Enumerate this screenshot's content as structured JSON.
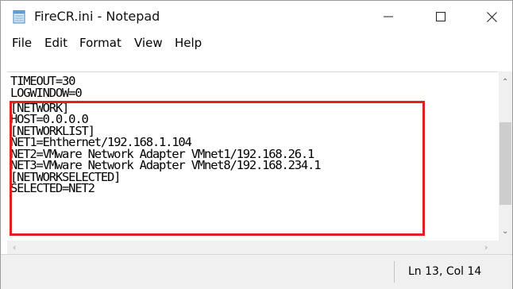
{
  "window": {
    "title": "FireCR.ini - Notepad",
    "icon": "notepad-icon",
    "controls": [
      "minimize-icon",
      "maximize-icon",
      "close-icon"
    ]
  },
  "menu": {
    "file": "File",
    "edit": "Edit",
    "format": "Format",
    "view": "View",
    "help": "Help"
  },
  "editor": {
    "lines": [
      "TIMEOUT=30",
      "LOGWINDOW=0",
      "[NETWORK]",
      "HOST=0.0.0.0",
      "[NETWORKLIST]",
      "NET1=Ehthernet/192.168.1.104",
      "NET2=VMware Network Adapter VMnet1/192.168.26.1",
      "NET3=VMware Network Adapter VMnet8/192.168.234.1",
      "[NETWORKSELECTED]",
      "SELECTED=NET2"
    ],
    "highlight_color": "#e02021"
  },
  "status": {
    "position": "Ln 13, Col 14"
  }
}
